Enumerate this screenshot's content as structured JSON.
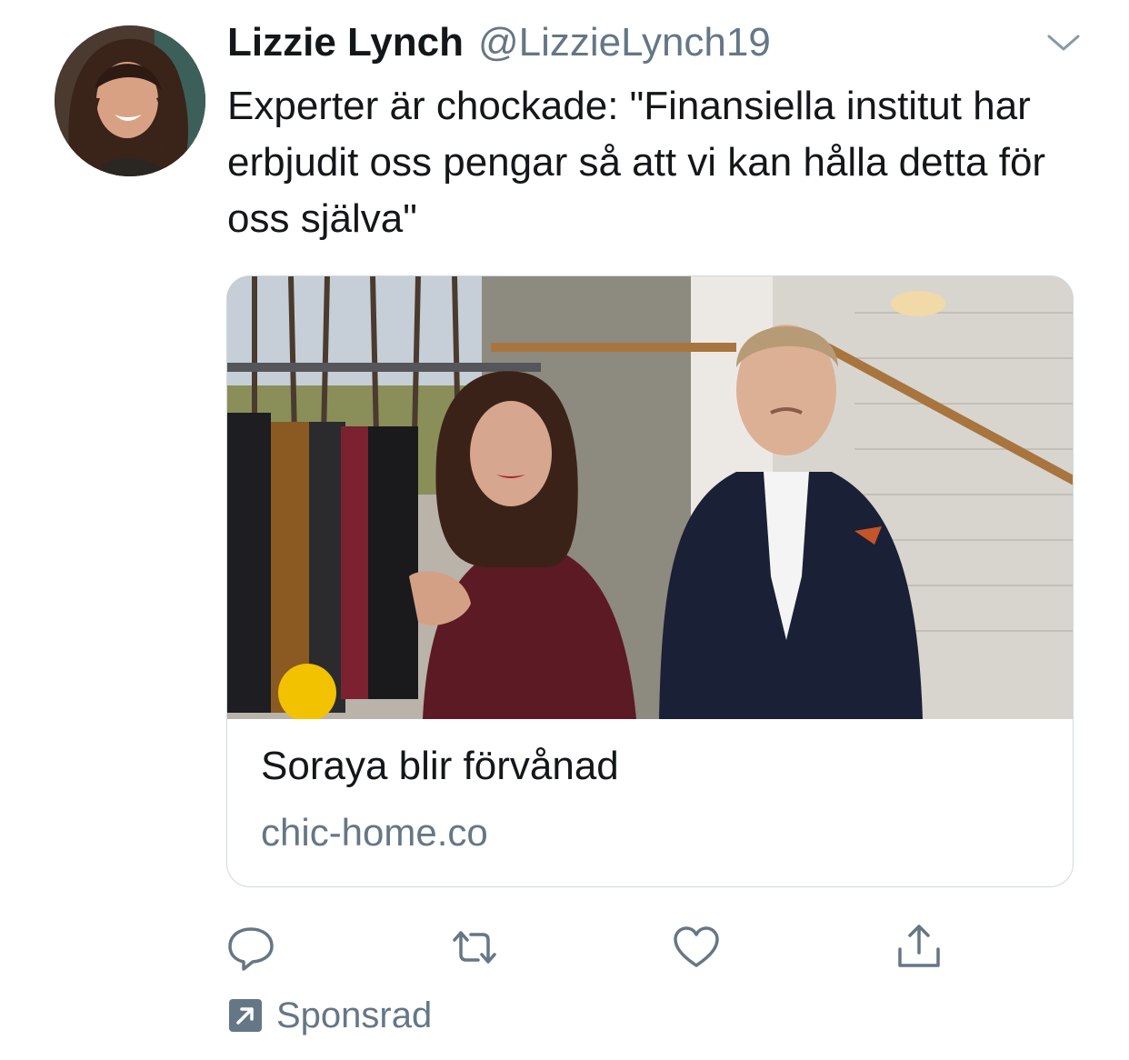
{
  "tweet": {
    "display_name": "Lizzie Lynch",
    "handle": "@LizzieLynch19",
    "text": "Experter är chockade: \"Finansiella institut har erbjudit oss pengar så att vi kan hålla detta för oss själva\""
  },
  "card": {
    "title": "Soraya blir förvånad",
    "domain": "chic-home.co"
  },
  "actions": {
    "reply_icon": "reply-icon",
    "retweet_icon": "retweet-icon",
    "like_icon": "heart-icon",
    "share_icon": "share-icon"
  },
  "promoted": {
    "label": "Sponsrad",
    "icon": "promoted-arrow-icon"
  },
  "colors": {
    "text_primary": "#14171a",
    "text_secondary": "#657786",
    "icon_gray": "#657786",
    "border": "#cfd9de"
  }
}
